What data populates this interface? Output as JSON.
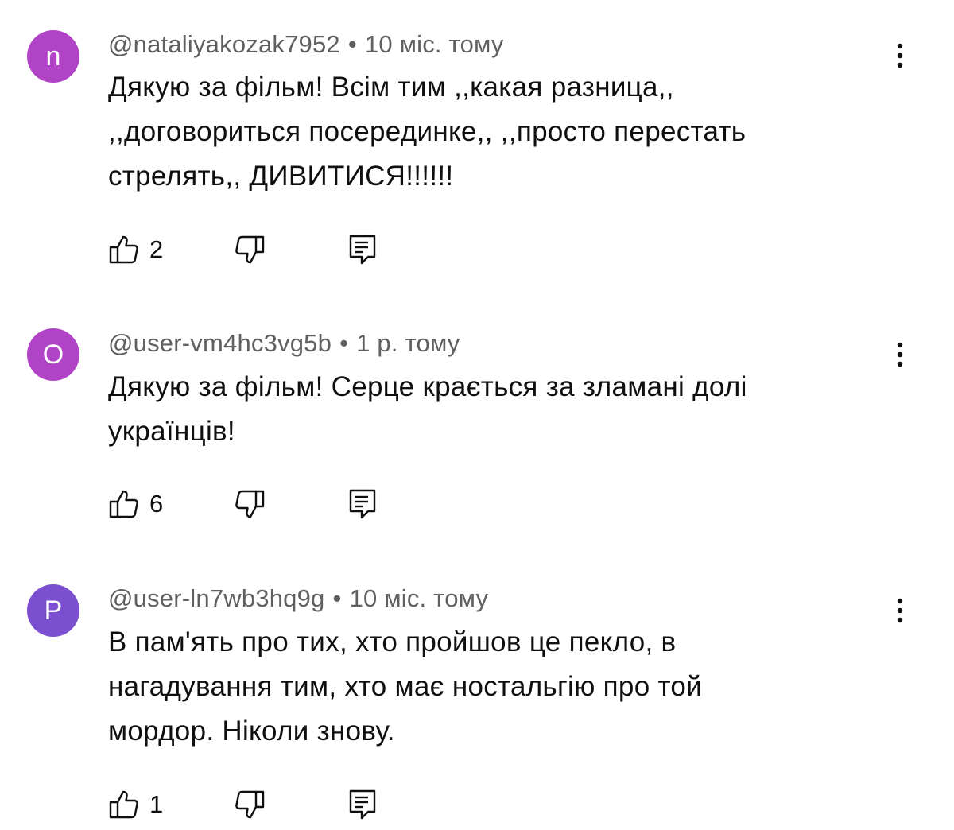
{
  "comments": [
    {
      "avatar_letter": "n",
      "avatar_color": "#b144c6",
      "author": "@nataliyakozak7952",
      "separator": "•",
      "time": "10 міс. тому",
      "text": "Дякую за фільм! Всім тим ,,какая разница,, ,,договориться посерединке,, ,,просто перестать стрелять,, ДИВИТИСЯ!!!!!!",
      "likes": "2"
    },
    {
      "avatar_letter": "O",
      "avatar_color": "#b144c6",
      "author": "@user-vm4hc3vg5b",
      "separator": "•",
      "time": "1 р. тому",
      "text": "Дякую за фільм! Серце крається за зламані долі українців!",
      "likes": "6"
    },
    {
      "avatar_letter": "P",
      "avatar_color": "#7b4fd0",
      "author": "@user-ln7wb3hq9g",
      "separator": "•",
      "time": "10 міс. тому",
      "text": "В пам'ять про тих, хто пройшов це пекло, в нагадування тим, хто має ностальгію про той мордор. Ніколи знову.",
      "likes": "1"
    }
  ],
  "icons": {
    "like": "thumb-up-icon",
    "dislike": "thumb-down-icon",
    "reply": "reply-comment-icon",
    "more": "more-vertical-icon"
  }
}
